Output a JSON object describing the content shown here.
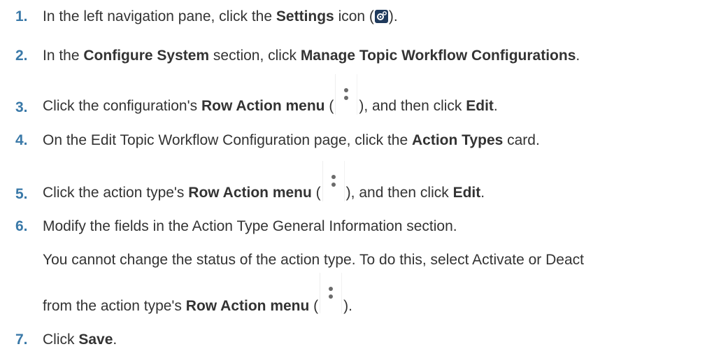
{
  "steps": [
    {
      "num": "1.",
      "parts": [
        "In the left navigation pane, click the ",
        "Settings",
        " icon (",
        ")."
      ]
    },
    {
      "num": "2.",
      "parts": [
        "In the ",
        "Configure System",
        " section, click ",
        "Manage Topic Workflow Configurations",
        "."
      ]
    },
    {
      "num": "3.",
      "parts": [
        "Click the configuration's ",
        "Row Action menu",
        " (",
        "), and then click ",
        "Edit",
        "."
      ]
    },
    {
      "num": "4.",
      "parts": [
        "On the Edit Topic Workflow Configuration page, click the ",
        "Action Types",
        " card."
      ]
    },
    {
      "num": "5.",
      "parts": [
        "Click the action type's ",
        "Row Action menu",
        " (",
        "), and then click ",
        "Edit",
        "."
      ]
    },
    {
      "num": "6.",
      "parts": [
        "Modify the fields in the Action Type General Information section."
      ]
    },
    {
      "num": "7.",
      "parts": [
        "Click ",
        "Save",
        "."
      ]
    }
  ],
  "note": {
    "line1": "You cannot change the status of the action type. To do this, select Activate or Deact",
    "line2_parts": [
      "from the action type's ",
      "Row Action menu",
      " (",
      ")."
    ]
  },
  "icons": {
    "settings": "settings-gear-icon",
    "row_action": "kebab-menu-icon"
  }
}
